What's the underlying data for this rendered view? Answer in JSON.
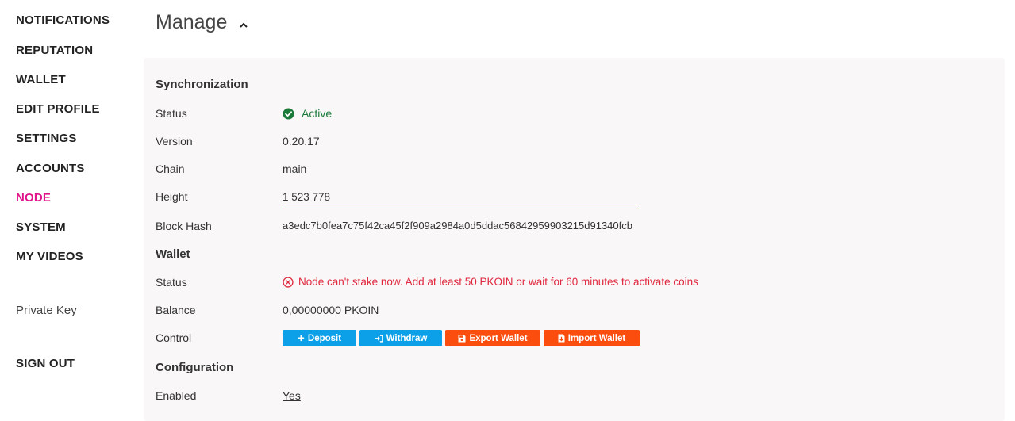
{
  "sidebar": {
    "items": [
      {
        "label": "NOTIFICATIONS"
      },
      {
        "label": "REPUTATION"
      },
      {
        "label": "WALLET"
      },
      {
        "label": "EDIT PROFILE"
      },
      {
        "label": "SETTINGS"
      },
      {
        "label": "ACCOUNTS"
      },
      {
        "label": "NODE",
        "active": true
      },
      {
        "label": "SYSTEM"
      },
      {
        "label": "MY VIDEOS"
      }
    ],
    "private_key": "Private Key",
    "sign_out": "SIGN OUT"
  },
  "header": {
    "title": "Manage",
    "toggle_icon": "chevron-up-icon"
  },
  "synchronization": {
    "title": "Synchronization",
    "status_label": "Status",
    "status_value": "Active",
    "status_icon": "check-circle-icon",
    "version_label": "Version",
    "version_value": "0.20.17",
    "chain_label": "Chain",
    "chain_value": "main",
    "height_label": "Height",
    "height_value": "1 523 778",
    "block_hash_label": "Block Hash",
    "block_hash_value": "a3edc7b0fea7c75f42ca45f2f909a2984a0d5ddac56842959903215d91340fcb"
  },
  "wallet": {
    "title": "Wallet",
    "status_label": "Status",
    "status_value": "Node can't stake now. Add at least 50 PKOIN or wait for 60 minutes to activate coins",
    "status_icon": "x-circle-icon",
    "balance_label": "Balance",
    "balance_value": "0,00000000 PKOIN",
    "control_label": "Control",
    "buttons": {
      "deposit": "Deposit",
      "withdraw": "Withdraw",
      "export": "Export Wallet",
      "import": "Import Wallet"
    }
  },
  "configuration": {
    "title": "Configuration",
    "enabled_label": "Enabled",
    "enabled_value": "Yes"
  },
  "colors": {
    "accent_active_nav": "#e0148a",
    "success": "#1b7a3a",
    "error": "#e0283e",
    "button_blue": "#0ba0e8",
    "button_orange": "#fb4d0e",
    "input_underline": "#1c8db5",
    "panel_bg": "#f9f7f8"
  }
}
